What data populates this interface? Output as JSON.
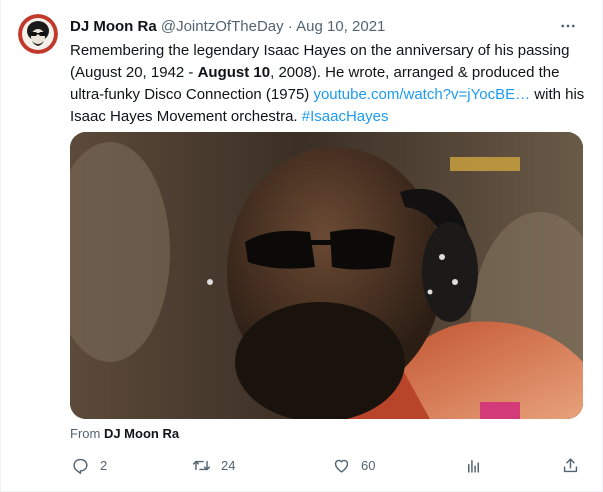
{
  "tweet": {
    "display_name": "DJ Moon Ra",
    "handle": "@JointzOfTheDay",
    "separator": "·",
    "date": "Aug 10, 2021",
    "text_part1": "Remembering the legendary Isaac Hayes on the anniversary of his passing (August 20, 1942 - ",
    "text_bold": "August 10",
    "text_part2": ", 2008). He wrote, arranged & produced the ultra-funky Disco Connection (1975) ",
    "link": "youtube.com/watch?v=jYocBE…",
    "text_part3": " with his Isaac Hayes Movement orchestra. ",
    "hashtag": "#IsaacHayes",
    "from_prefix": "From ",
    "from_name": "DJ Moon Ra"
  },
  "actions": {
    "reply": {
      "icon": "reply-icon",
      "count": "2"
    },
    "retweet": {
      "icon": "retweet-icon",
      "count": "24"
    },
    "like": {
      "icon": "heart-icon",
      "count": "60"
    },
    "views": {
      "icon": "analytics-icon"
    },
    "share": {
      "icon": "share-icon"
    }
  },
  "colors": {
    "accent": "#1d9bf0",
    "secondary_text": "#536471",
    "primary_text": "#0f1419"
  }
}
